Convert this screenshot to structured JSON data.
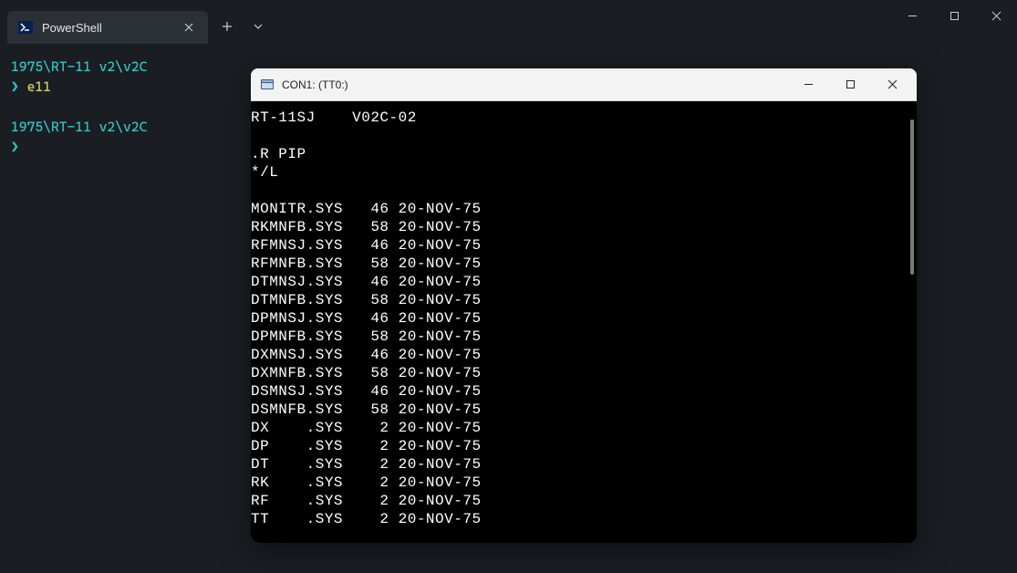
{
  "terminal": {
    "tab_title": "PowerShell",
    "prompt1_path": "1975\\RT-11 v2\\v2C",
    "prompt1_cmd": "e11",
    "prompt2_path": "1975\\RT-11 v2\\v2C",
    "prompt_symbol": "❯"
  },
  "console": {
    "title": "CON1: (TT0:)",
    "header": "RT-11SJ    V02C-02",
    "cmd1": ".R PIP",
    "cmd2": "*/L",
    "files": [
      {
        "name": "MONITR.SYS",
        "size": "46",
        "date": "20-NOV-75"
      },
      {
        "name": "RKMNFB.SYS",
        "size": "58",
        "date": "20-NOV-75"
      },
      {
        "name": "RFMNSJ.SYS",
        "size": "46",
        "date": "20-NOV-75"
      },
      {
        "name": "RFMNFB.SYS",
        "size": "58",
        "date": "20-NOV-75"
      },
      {
        "name": "DTMNSJ.SYS",
        "size": "46",
        "date": "20-NOV-75"
      },
      {
        "name": "DTMNFB.SYS",
        "size": "58",
        "date": "20-NOV-75"
      },
      {
        "name": "DPMNSJ.SYS",
        "size": "46",
        "date": "20-NOV-75"
      },
      {
        "name": "DPMNFB.SYS",
        "size": "58",
        "date": "20-NOV-75"
      },
      {
        "name": "DXMNSJ.SYS",
        "size": "46",
        "date": "20-NOV-75"
      },
      {
        "name": "DXMNFB.SYS",
        "size": "58",
        "date": "20-NOV-75"
      },
      {
        "name": "DSMNSJ.SYS",
        "size": "46",
        "date": "20-NOV-75"
      },
      {
        "name": "DSMNFB.SYS",
        "size": "58",
        "date": "20-NOV-75"
      },
      {
        "name": "DX    .SYS",
        "size": "2",
        "date": "20-NOV-75"
      },
      {
        "name": "DP    .SYS",
        "size": "2",
        "date": "20-NOV-75"
      },
      {
        "name": "DT    .SYS",
        "size": "2",
        "date": "20-NOV-75"
      },
      {
        "name": "RK    .SYS",
        "size": "2",
        "date": "20-NOV-75"
      },
      {
        "name": "RF    .SYS",
        "size": "2",
        "date": "20-NOV-75"
      },
      {
        "name": "TT    .SYS",
        "size": "2",
        "date": "20-NOV-75"
      }
    ]
  }
}
